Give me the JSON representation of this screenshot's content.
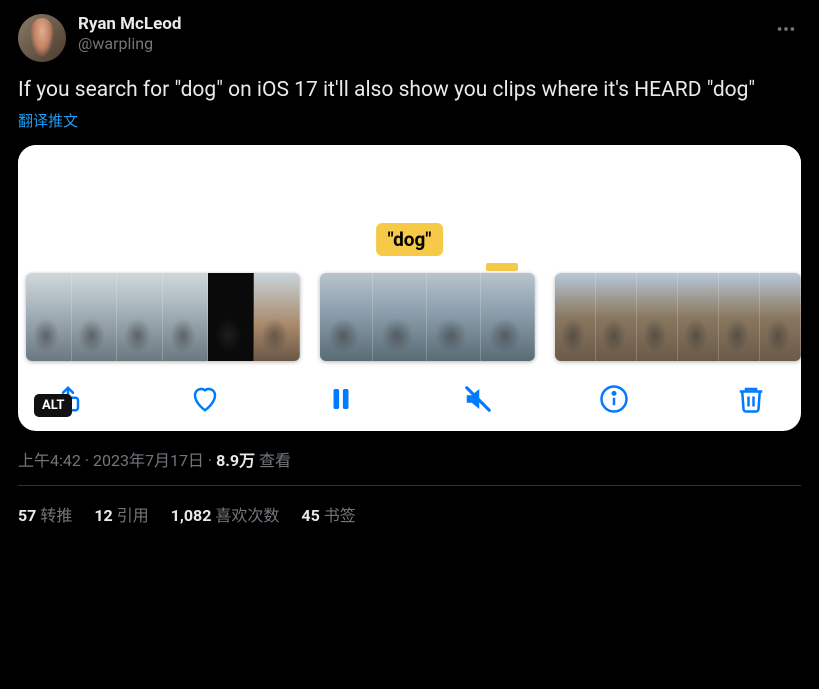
{
  "author": {
    "display_name": "Ryan McLeod",
    "handle": "@warpling"
  },
  "tweet_text": "If you search for \"dog\" on iOS 17 it'll also show you clips where it's HEARD \"dog\"",
  "translate_label": "翻译推文",
  "media": {
    "dog_tag": "\"dog\"",
    "alt_badge": "ALT"
  },
  "meta": {
    "time": "上午4:42",
    "sep1": " · ",
    "date": "2023年7月17日",
    "sep2": " · ",
    "views_count": "8.9万",
    "views_label": " 查看"
  },
  "stats": {
    "retweets": {
      "count": "57",
      "label": "转推"
    },
    "quotes": {
      "count": "12",
      "label": "引用"
    },
    "likes": {
      "count": "1,082",
      "label": "喜欢次数"
    },
    "bookmarks": {
      "count": "45",
      "label": "书签"
    }
  }
}
